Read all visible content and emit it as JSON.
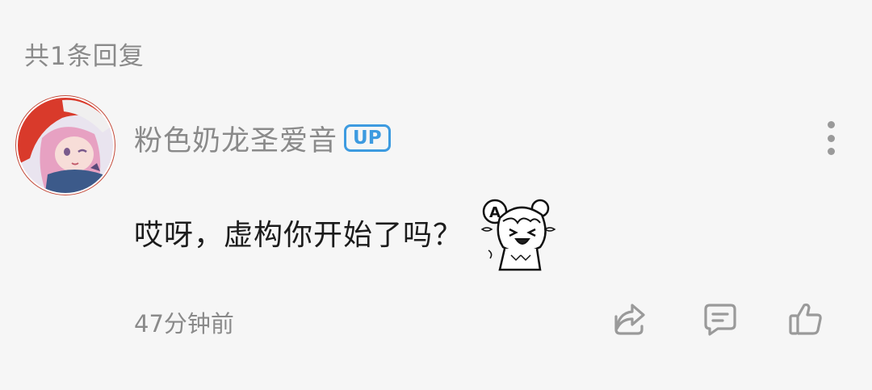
{
  "header": {
    "reply_count": "共1条回复"
  },
  "comment": {
    "username": "粉色奶龙圣爱音",
    "badge": "UP",
    "text": "哎呀，虚构你开始了吗？",
    "time": "47分钟前",
    "sticker_icon": "anime-girl-laughing-sticker"
  },
  "actions": {
    "share_icon": "share-icon",
    "reply_icon": "reply-comment-icon",
    "like_icon": "thumbs-up-icon"
  },
  "colors": {
    "background": "#f6f6f6",
    "badge_blue": "#3d9be0",
    "secondary_text": "#8a8a8a",
    "primary_text": "#1c1c1c",
    "icon_gray": "#9a9a9a"
  }
}
